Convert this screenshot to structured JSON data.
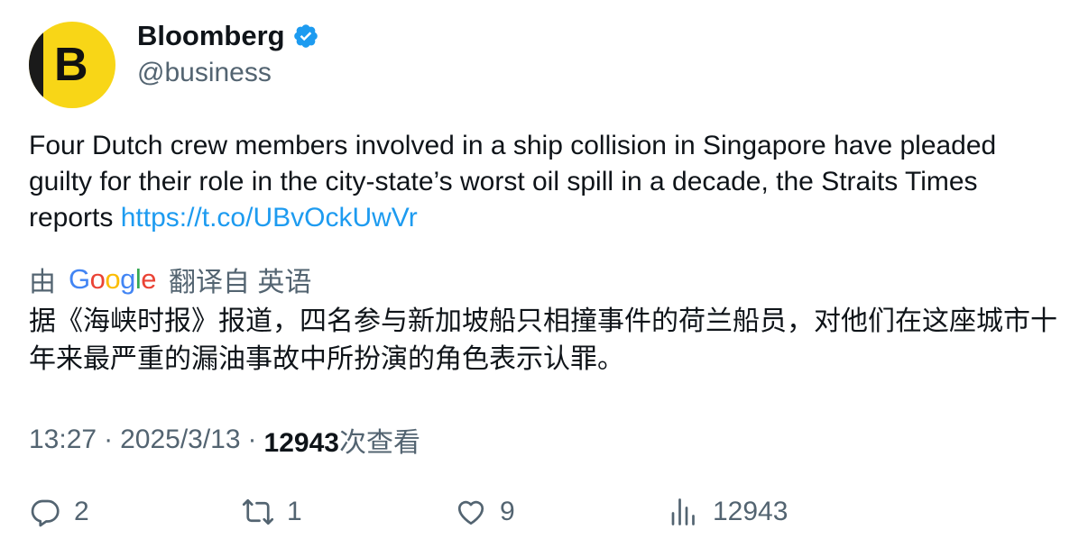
{
  "author": {
    "display_name": "Bloomberg",
    "handle": "@business",
    "avatar_letter": "B",
    "verified": true,
    "avatar_color": "#f8d617"
  },
  "tweet": {
    "text": "Four Dutch crew members involved in a ship collision in Singapore have pleaded guilty for their role in the city-state’s worst oil spill in a decade, the Straits Times reports ",
    "link": "https://t.co/UBvOckUwVr",
    "link_color": "#1d9bf0"
  },
  "translation": {
    "prefix": "由",
    "provider": "Google",
    "suffix": "翻译自 英语",
    "text": "据《海峡时报》报道，四名参与新加坡船只相撞事件的荷兰船员，对他们在这座城市十年来最严重的漏油事故中所扮演的角色表示认罪。"
  },
  "meta": {
    "time": "13:27",
    "separator": "·",
    "date": "2025/3/13",
    "views": "12943",
    "views_label": "次查看"
  },
  "actions": {
    "replies": "2",
    "retweets": "1",
    "likes": "9",
    "views": "12943"
  },
  "colors": {
    "text": "#0f1419",
    "secondary": "#536471",
    "accent": "#1d9bf0"
  }
}
